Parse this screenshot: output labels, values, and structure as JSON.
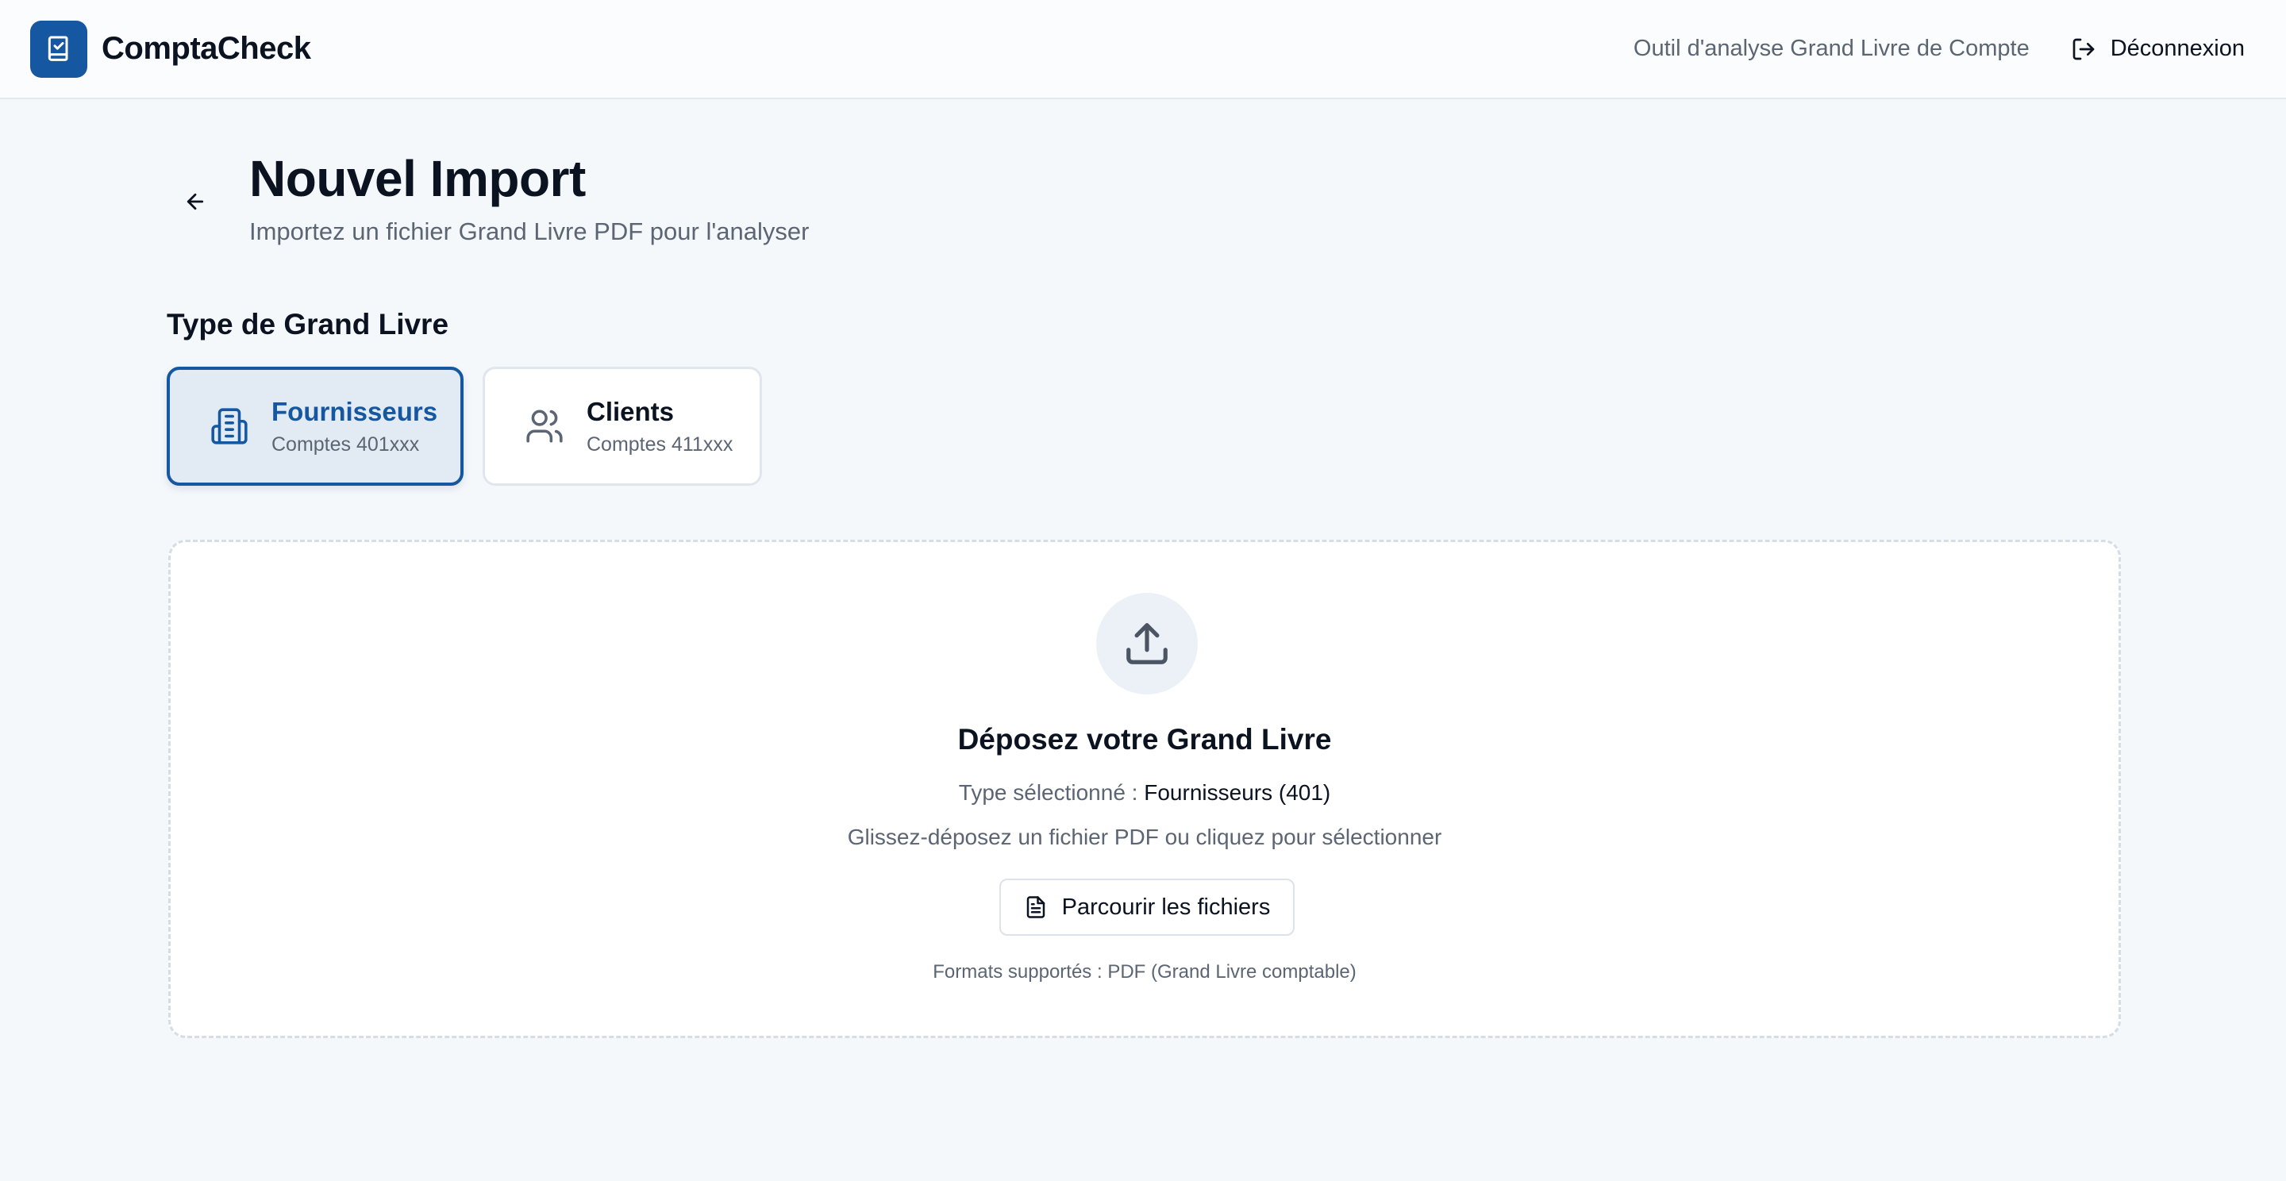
{
  "header": {
    "brand_name": "ComptaCheck",
    "tagline": "Outil d'analyse Grand Livre de Compte",
    "logout_label": "Déconnexion"
  },
  "page": {
    "title": "Nouvel Import",
    "subtitle": "Importez un fichier Grand Livre PDF pour l'analyser"
  },
  "type_section": {
    "label": "Type de Grand Livre",
    "options": [
      {
        "title": "Fournisseurs",
        "subtitle": "Comptes 401xxx",
        "selected": true,
        "icon": "building-icon"
      },
      {
        "title": "Clients",
        "subtitle": "Comptes 411xxx",
        "selected": false,
        "icon": "users-icon"
      }
    ]
  },
  "dropzone": {
    "title": "Déposez votre Grand Livre",
    "selected_prefix": "Type sélectionné :",
    "selected_value": "Fournisseurs (401)",
    "instruction": "Glissez-déposez un fichier PDF ou cliquez pour sélectionner",
    "browse_label": "Parcourir les fichiers",
    "formats": "Formats supportés : PDF (Grand Livre comptable)"
  },
  "colors": {
    "primary": "#1557a0",
    "background": "#f5f8fb",
    "muted_text": "#5b6573"
  }
}
